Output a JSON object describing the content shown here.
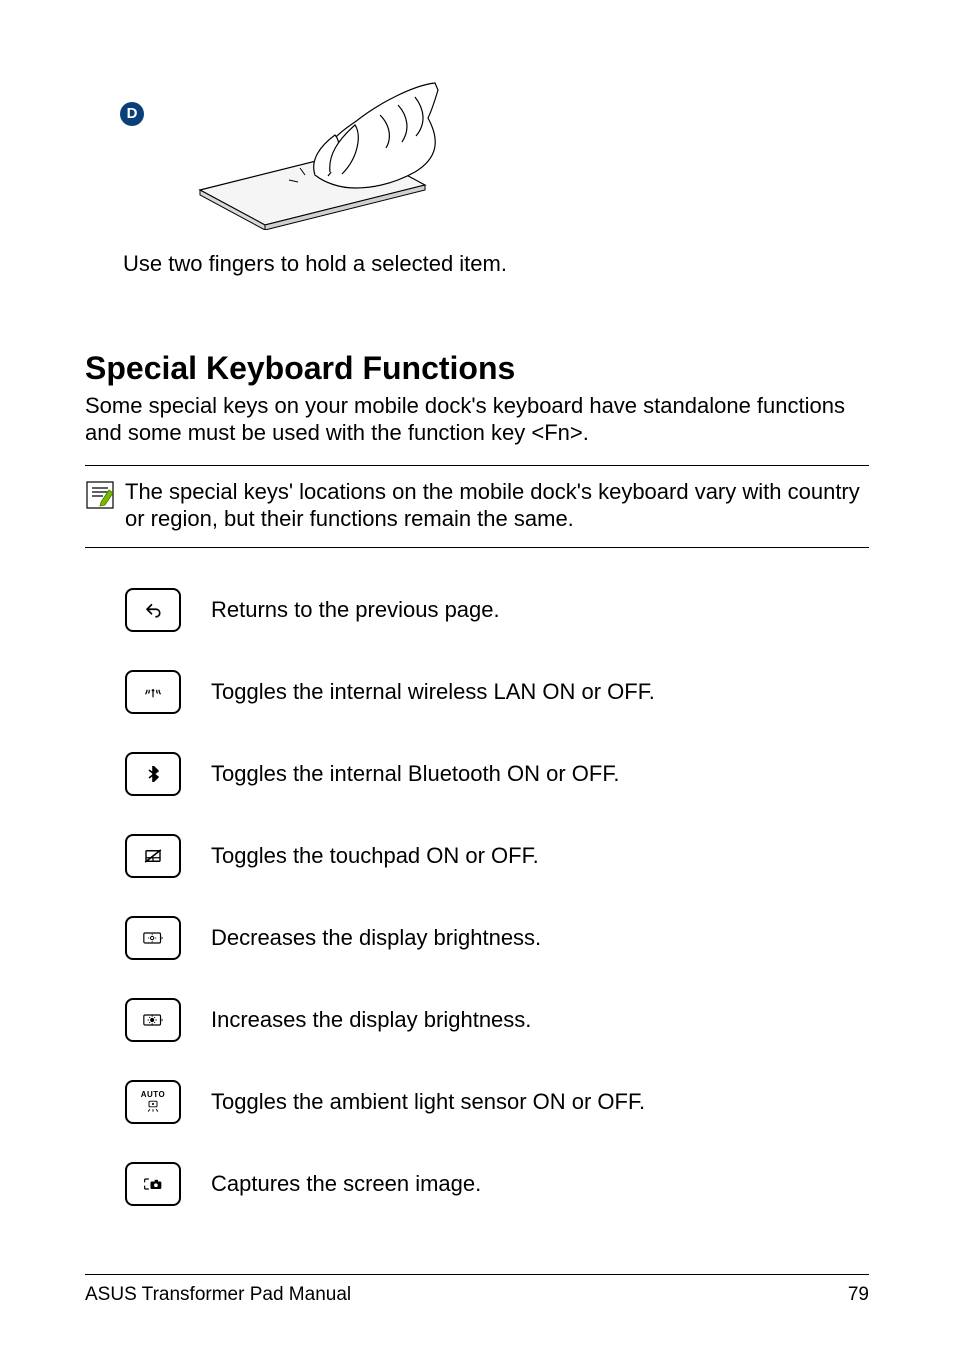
{
  "callout_letter": "D",
  "touchpad_caption": "Use two fingers to hold a selected item.",
  "section_title": "Special Keyboard Functions",
  "intro_text": "Some special keys on your mobile dock's keyboard have standalone functions and some must be used with the function key <Fn>.",
  "note_text": "The special keys' locations on the mobile dock's keyboard vary with country or region, but their functions remain the same.",
  "keys": [
    {
      "icon": "back-arrow-icon",
      "desc": "Returns to the previous page."
    },
    {
      "icon": "wifi-icon",
      "desc": "Toggles the internal wireless LAN ON or OFF."
    },
    {
      "icon": "bluetooth-icon",
      "desc": "Toggles the internal Bluetooth ON or OFF."
    },
    {
      "icon": "touchpad-off-icon",
      "desc": "Toggles the touchpad ON or OFF."
    },
    {
      "icon": "brightness-down-icon",
      "desc": "Decreases the display brightness."
    },
    {
      "icon": "brightness-up-icon",
      "desc": "Increases the display brightness."
    },
    {
      "icon": "auto-light-icon",
      "auto_label": "AUTO",
      "desc": "Toggles the ambient light sensor ON or OFF."
    },
    {
      "icon": "screenshot-icon",
      "desc": "Captures the screen image."
    }
  ],
  "footer": {
    "title": "ASUS Transformer Pad Manual",
    "page_number": "79"
  }
}
